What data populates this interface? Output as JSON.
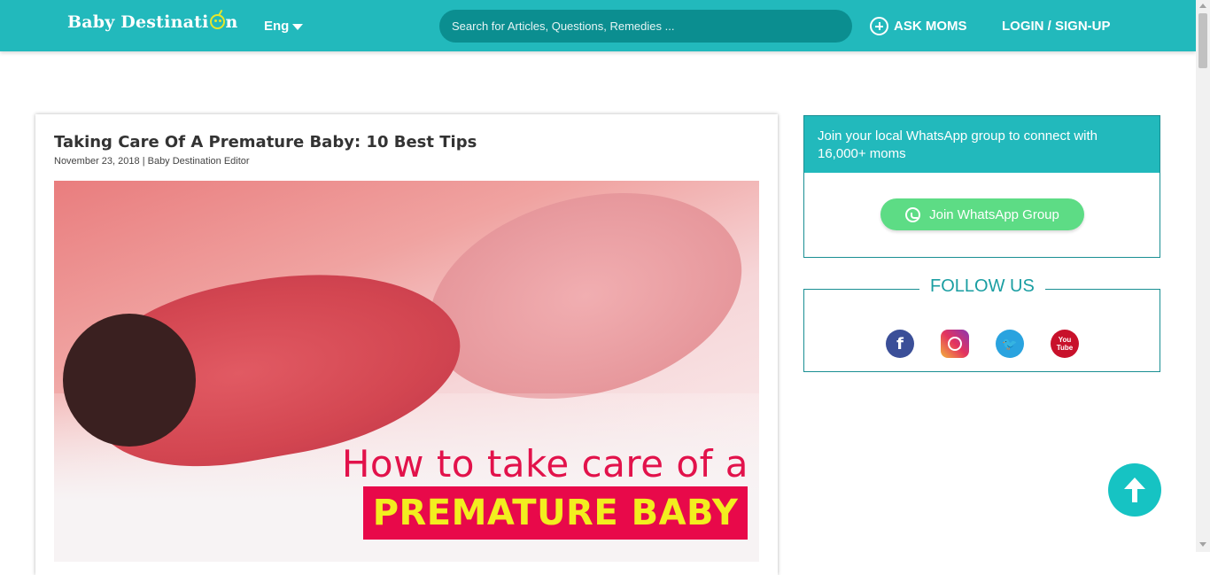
{
  "header": {
    "logo_text": "Baby Destinati",
    "logo_end": "n",
    "language": "Eng",
    "search_placeholder": "Search for Articles, Questions, Remedies ...",
    "ask_label": "ASK MOMS",
    "login_label": "LOGIN / SIGN-UP"
  },
  "article": {
    "title": "Taking Care Of A Premature Baby: 10 Best Tips",
    "date": "November 23, 2018",
    "separator": "|",
    "author": "Baby Destination Editor",
    "image_line1": "How to take care of a",
    "image_line2": "PREMATURE BABY"
  },
  "whatsapp": {
    "heading": "Join your local WhatsApp group to connect with 16,000+ moms",
    "button_label": "Join WhatsApp Group"
  },
  "follow": {
    "title": "FOLLOW US",
    "facebook": "f",
    "twitter": "🐦",
    "youtube_top": "You",
    "youtube_bottom": "Tube"
  },
  "colors": {
    "brand": "#22b9bc",
    "search_bg": "#0b8e90",
    "whatsapp_button": "#5ddc85",
    "accent_pink": "#e8094a",
    "accent_yellow": "#f2ee1f"
  },
  "icons": [
    "caret-down-icon",
    "plus-circle-icon",
    "whatsapp-icon",
    "facebook-icon",
    "instagram-icon",
    "twitter-icon",
    "youtube-icon",
    "arrow-up-icon"
  ]
}
